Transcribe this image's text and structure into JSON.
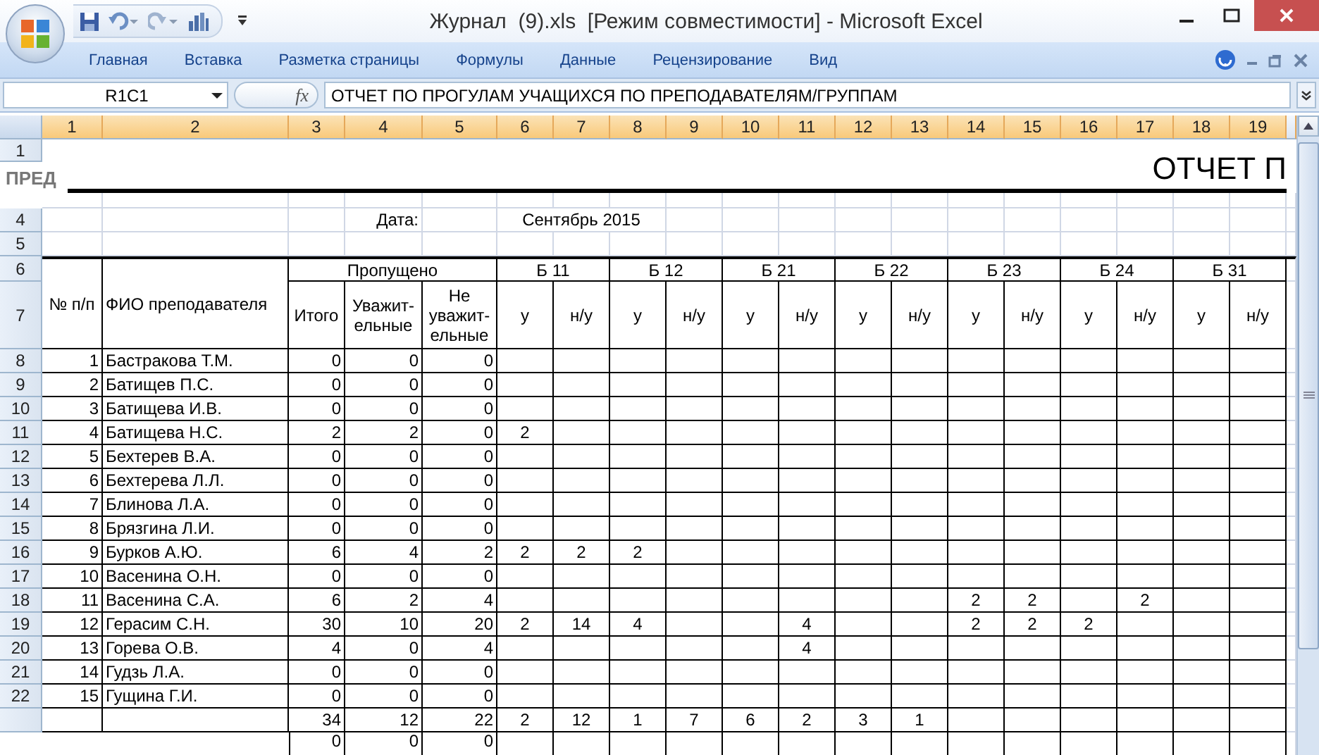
{
  "window": {
    "title": "Журнал  (9).xls  [Режим совместимости] - Microsoft Excel"
  },
  "ribbon": {
    "tabs": [
      {
        "label": "Главная",
        "selected": false
      },
      {
        "label": "Вставка",
        "selected": false
      },
      {
        "label": "Разметка страницы",
        "selected": false
      },
      {
        "label": "Формулы",
        "selected": false
      },
      {
        "label": "Данные",
        "selected": false
      },
      {
        "label": "Рецензирование",
        "selected": false
      },
      {
        "label": "Вид",
        "selected": false
      }
    ]
  },
  "formula_bar": {
    "name_box": "R1C1",
    "function_symbol": "fx",
    "formula": "ОТЧЕТ ПО ПРОГУЛАМ УЧАЩИХСЯ ПО ПРЕПОДАВАТЕЛЯМ/ГРУППАМ"
  },
  "sheet": {
    "column_headers": [
      {
        "label": "1",
        "selected": true
      },
      {
        "label": "2",
        "selected": true
      },
      {
        "label": "3",
        "selected": true
      },
      {
        "label": "4",
        "selected": true
      },
      {
        "label": "5",
        "selected": true
      },
      {
        "label": "6",
        "selected": true
      },
      {
        "label": "7",
        "selected": true
      },
      {
        "label": "8",
        "selected": true
      },
      {
        "label": "9",
        "selected": true
      },
      {
        "label": "10",
        "selected": true
      },
      {
        "label": "11",
        "selected": true
      },
      {
        "label": "12",
        "selected": true
      },
      {
        "label": "13",
        "selected": true
      },
      {
        "label": "14",
        "selected": true
      },
      {
        "label": "15",
        "selected": true
      },
      {
        "label": "16",
        "selected": true
      },
      {
        "label": "17",
        "selected": true
      },
      {
        "label": "18",
        "selected": true
      },
      {
        "label": "19",
        "selected": true
      }
    ],
    "row_headers": [
      "1",
      "4",
      "5",
      "6",
      "7",
      "8",
      "9",
      "10",
      "11",
      "12",
      "13",
      "14",
      "15",
      "16",
      "17",
      "18",
      "19",
      "20",
      "21",
      "22"
    ],
    "overlay_label": "ПРЕД",
    "title": "ОТЧЕТ П",
    "date_label": "Дата:",
    "date_value": "Сентябрь 2015",
    "table": {
      "index_heading": "№ п/п",
      "name_heading": "ФИО преподавателя",
      "missed_heading": "Пропущено",
      "missed_columns": [
        "Итого",
        "Уважит-\nельные",
        "Не\nуважит-\nельные"
      ],
      "groups": [
        {
          "label": "Б 11",
          "columns": [
            "у",
            "н/у"
          ]
        },
        {
          "label": "Б 12",
          "columns": [
            "у",
            "н/у"
          ]
        },
        {
          "label": "Б 21",
          "columns": [
            "у",
            "н/у"
          ]
        },
        {
          "label": "Б 22",
          "columns": [
            "у",
            "н/у"
          ]
        },
        {
          "label": "Б 23",
          "columns": [
            "у",
            "н/у"
          ]
        },
        {
          "label": "Б 24",
          "columns": [
            "у",
            "н/у"
          ]
        },
        {
          "label": "Б 31",
          "columns": [
            "у",
            "н/у"
          ]
        }
      ],
      "rows": [
        {
          "index": "1",
          "name": "Бастракова Т.М.",
          "total": "0",
          "excused": "0",
          "unexcused": "0"
        },
        {
          "index": "2",
          "name": "Батищев П.С.",
          "total": "0",
          "excused": "0",
          "unexcused": "0"
        },
        {
          "index": "3",
          "name": "Батищева И.В.",
          "total": "0",
          "excused": "0",
          "unexcused": "0"
        },
        {
          "index": "4",
          "name": "Батищева Н.С.",
          "total": "2",
          "excused": "2",
          "unexcused": "0",
          "b11_u": "2"
        },
        {
          "index": "5",
          "name": "Бехтерев В.А.",
          "total": "0",
          "excused": "0",
          "unexcused": "0"
        },
        {
          "index": "6",
          "name": "Бехтерева Л.Л.",
          "total": "0",
          "excused": "0",
          "unexcused": "0"
        },
        {
          "index": "7",
          "name": "Блинова Л.А.",
          "total": "0",
          "excused": "0",
          "unexcused": "0"
        },
        {
          "index": "8",
          "name": "Брязгина Л.И.",
          "total": "0",
          "excused": "0",
          "unexcused": "0"
        },
        {
          "index": "9",
          "name": "Бурков А.Ю.",
          "total": "6",
          "excused": "4",
          "unexcused": "2",
          "b11_u": "2",
          "b11_nu": "2",
          "b12_u": "2"
        },
        {
          "index": "10",
          "name": "Васенина О.Н.",
          "total": "0",
          "excused": "0",
          "unexcused": "0"
        },
        {
          "index": "11",
          "name": "Васенина С.А.",
          "total": "6",
          "excused": "2",
          "unexcused": "4",
          "b23_u": "2",
          "b23_nu": "2",
          "b24_nu": "2"
        },
        {
          "index": "12",
          "name": "Герасим С.Н.",
          "total": "30",
          "excused": "10",
          "unexcused": "20",
          "b11_u": "2",
          "b11_nu": "14",
          "b12_u": "4",
          "b21_nu": "4",
          "b23_u": "2",
          "b23_nu": "2",
          "b24_u": "2"
        },
        {
          "index": "13",
          "name": "Горева О.В.",
          "total": "4",
          "excused": "0",
          "unexcused": "4",
          "b21_nu": "4"
        },
        {
          "index": "14",
          "name": "Гудзь Л.А.",
          "total": "0",
          "excused": "0",
          "unexcused": "0"
        },
        {
          "index": "15",
          "name": "Гущина Г.И.",
          "total": "0",
          "excused": "0",
          "unexcused": "0"
        },
        {
          "total": "34",
          "excused": "12",
          "unexcused": "22",
          "b11_u": "2",
          "b11_nu": "12",
          "b12_u": "1",
          "b12_nu": "7",
          "b21_u": "6",
          "b21_nu": "2",
          "b22_u": "3",
          "b22_nu": "1"
        },
        {
          "total": "0",
          "excused": "0",
          "unexcused": "0"
        }
      ]
    }
  }
}
